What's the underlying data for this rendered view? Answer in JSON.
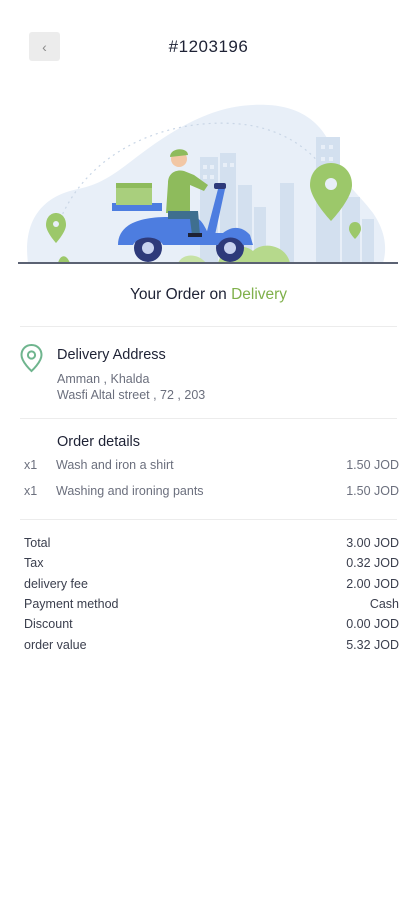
{
  "header": {
    "back_icon": "chevron-left-icon",
    "order_id": "#1203196"
  },
  "hero": {
    "illustration": "delivery-scooter-illustration"
  },
  "status": {
    "prefix": "Your Order on ",
    "state": "Delivery",
    "accent_color": "#7fb04a"
  },
  "address": {
    "icon": "location-pin-icon",
    "title": "Delivery Address",
    "line1": "Amman , Khalda",
    "line2": "Wasfi Altal street , 72 , 203"
  },
  "order_details": {
    "title": "Order details",
    "items": [
      {
        "qty": "x1",
        "name": "Wash and iron a shirt",
        "price": "1.50 JOD"
      },
      {
        "qty": "x1",
        "name": "Washing and ironing pants",
        "price": "1.50 JOD"
      }
    ]
  },
  "summary": [
    {
      "label": "Total",
      "value": "3.00 JOD"
    },
    {
      "label": "Tax",
      "value": "0.32 JOD"
    },
    {
      "label": "delivery fee",
      "value": "2.00 JOD"
    },
    {
      "label": "Payment method",
      "value": "Cash"
    },
    {
      "label": "Discount",
      "value": "0.00 JOD"
    },
    {
      "label": "order value",
      "value": "5.32 JOD"
    }
  ]
}
